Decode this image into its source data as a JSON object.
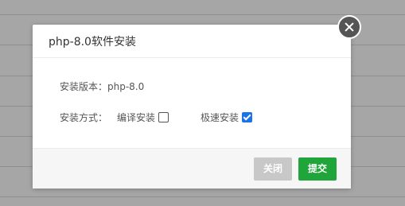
{
  "dialog": {
    "title": "php-8.0软件安装",
    "version_label": "安装版本：",
    "version_value": "php-8.0",
    "method_label": "安装方式：",
    "options": [
      {
        "label": "编译安装",
        "checked": false
      },
      {
        "label": "极速安装",
        "checked": true
      }
    ],
    "close_label": "关闭",
    "submit_label": "提交"
  },
  "colors": {
    "submit": "#20a53a",
    "close_button": "#c8c8c8",
    "checkbox_checked": "#1a73e8"
  }
}
